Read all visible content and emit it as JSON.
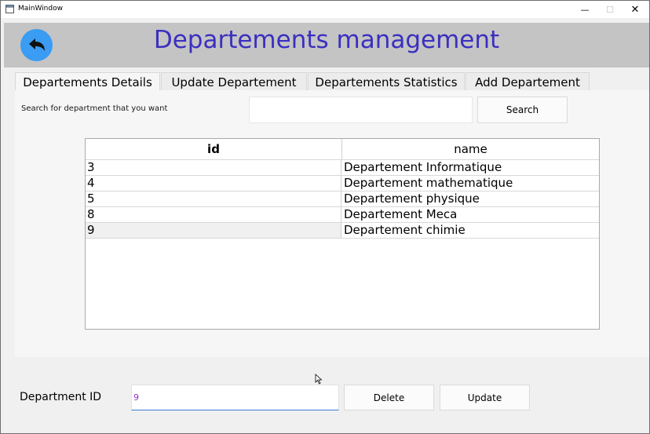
{
  "window": {
    "title": "MainWindow",
    "controls": {
      "minimize": "—",
      "maximize": "☐",
      "close": "✕"
    }
  },
  "header": {
    "title": "Departements management",
    "back_icon": "back-arrow-icon",
    "title_color": "#3b2fc0",
    "back_color": "#3a9cf2"
  },
  "tabs": [
    {
      "label": "Departements Details",
      "active": true
    },
    {
      "label": "Update Departement",
      "active": false
    },
    {
      "label": "Departements Statistics",
      "active": false
    },
    {
      "label": "Add Departement",
      "active": false
    }
  ],
  "search": {
    "label": "Search for department that you want",
    "value": "",
    "button": "Search"
  },
  "table": {
    "columns": [
      "id",
      "name"
    ],
    "rows": [
      {
        "id": "3",
        "name": "Departement Informatique"
      },
      {
        "id": "4",
        "name": "Departement mathematique"
      },
      {
        "id": "5",
        "name": "Departement physique"
      },
      {
        "id": "8",
        "name": "Departement Meca"
      },
      {
        "id": "9",
        "name": "Departement chimie"
      }
    ]
  },
  "bottom": {
    "label": "Department ID",
    "value": "9",
    "delete": "Delete",
    "update": "Update"
  }
}
